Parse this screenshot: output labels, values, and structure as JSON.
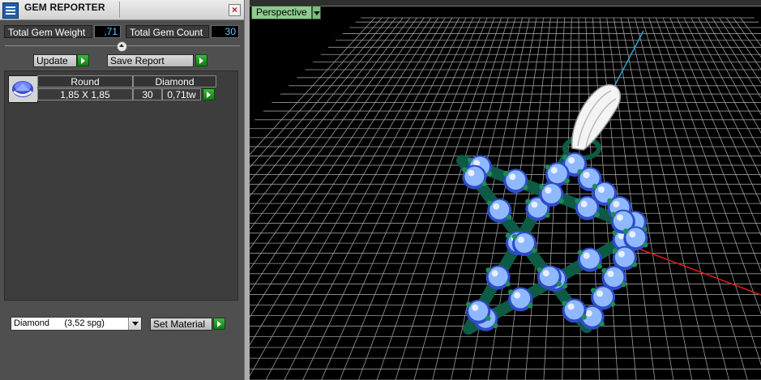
{
  "panel": {
    "title": "GEM REPORTER",
    "total_gem_weight_label": "Total Gem Weight",
    "total_gem_weight_value": ",71",
    "total_gem_count_label": "Total Gem Count",
    "total_gem_count_value": "30",
    "update_label": "Update",
    "save_report_label": "Save Report",
    "gem_table": {
      "headers": [
        "Round",
        "Diamond"
      ],
      "row": {
        "size": "1,85 X 1,85",
        "count": "30",
        "weight": "0,71tw"
      }
    },
    "material_select_value": "Diamond      (3,52 spg)",
    "set_material_label": "Set Material"
  },
  "viewport": {
    "view_mode": "Perspective",
    "grid_color": "#9a9a9a",
    "model_color": "#0d5a45",
    "gem_color": "#8fb8ff",
    "x_axis_color": "#e01818",
    "z_axis_color": "#2aa4c8"
  }
}
